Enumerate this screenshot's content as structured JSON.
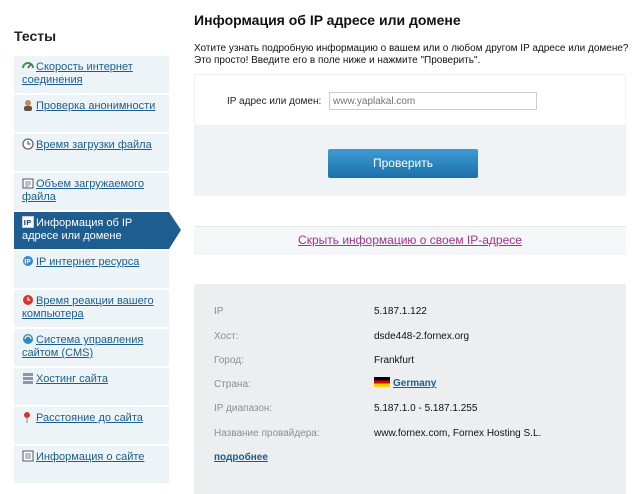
{
  "sidebar": {
    "title": "Тесты",
    "items": [
      {
        "label": "Скорость интернет соединения",
        "icon": "speed-icon"
      },
      {
        "label": "Проверка анонимности",
        "icon": "user-icon"
      },
      {
        "label": "Время загрузки файла",
        "icon": "clock-icon"
      },
      {
        "label": "Объем загружаемого файла",
        "icon": "file-size-icon"
      },
      {
        "label": "Информация об IP адресе или домене",
        "icon": "ip-icon"
      },
      {
        "label": "IP интернет ресурса",
        "icon": "globe-icon"
      },
      {
        "label": "Время реакции вашего компьютера",
        "icon": "reaction-icon"
      },
      {
        "label": "Система управления сайтом (CMS)",
        "icon": "cms-icon"
      },
      {
        "label": "Хостинг сайта",
        "icon": "hosting-icon"
      },
      {
        "label": "Расстояние до сайта",
        "icon": "pin-icon"
      },
      {
        "label": "Информация о сайте",
        "icon": "site-info-icon"
      }
    ]
  },
  "main": {
    "title": "Информация об IP адресе или домене",
    "intro": "Хотите узнать подробную информацию о вашем или о любом другом IP адресе или домене? Это просто! Введите его в поле ниже и нажмите \"Проверить\".",
    "form": {
      "label": "IP адрес или домен:",
      "placeholder": "www.yaplakal.com",
      "button": "Проверить"
    },
    "hide_link": "Скрыть информацию о своем IP-адресе",
    "info": {
      "ip_label": "IP",
      "ip_value": "5.187.1.122",
      "host_label": "Хост:",
      "host_value": "dsde448-2.fornex.org",
      "city_label": "Город:",
      "city_value": "Frankfurt",
      "country_label": "Страна:",
      "country_value": "Germany",
      "range_label": "IP диапазон:",
      "range_value": "5.187.1.0 - 5.187.1.255",
      "provider_label": "Название провайдера:",
      "provider_value": "www.fornex.com, Fornex Hosting S.L.",
      "more": "подробнее"
    }
  }
}
